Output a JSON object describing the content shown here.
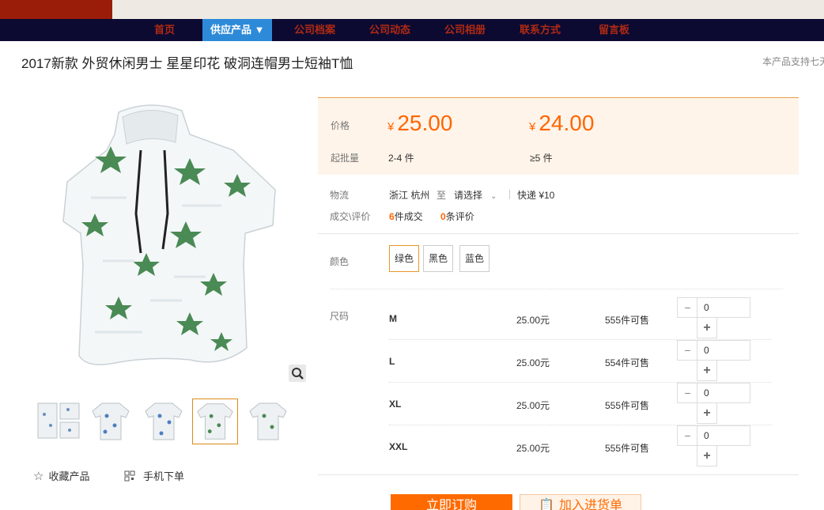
{
  "nav": {
    "items": [
      "首页",
      "供应产品 ▼",
      "公司档案",
      "公司动态",
      "公司相册",
      "联系方式",
      "留言板"
    ]
  },
  "product": {
    "title": "2017新款 外贸休闲男士 星星印花 破洞连帽男士短袖T恤",
    "support_text": "本产品支持七天"
  },
  "pricing": {
    "price_label": "价格",
    "moq_label": "起批量",
    "currency": "¥",
    "tiers": [
      {
        "price": "25.00",
        "qty": "2-4 件"
      },
      {
        "price": "24.00",
        "qty": "≥5 件"
      }
    ]
  },
  "logistics": {
    "label": "物流",
    "from": "浙江 杭州",
    "to_word": "至",
    "select": "请选择",
    "express": "快递 ¥10"
  },
  "deals": {
    "label": "成交\\评价",
    "count": "6",
    "count_suffix": "件成交",
    "reviews": "0",
    "reviews_suffix": "条评价"
  },
  "color": {
    "label": "颜色",
    "options": [
      "绿色",
      "黑色",
      "蓝色"
    ],
    "selected": "绿色"
  },
  "size": {
    "label": "尺码",
    "rows": [
      {
        "size": "M",
        "price": "25.00元",
        "stock": "555件可售",
        "qty": "0"
      },
      {
        "size": "L",
        "price": "25.00元",
        "stock": "554件可售",
        "qty": "0"
      },
      {
        "size": "XL",
        "price": "25.00元",
        "stock": "555件可售",
        "qty": "0"
      },
      {
        "size": "XXL",
        "price": "25.00元",
        "stock": "555件可售",
        "qty": "0"
      }
    ]
  },
  "actions": {
    "favorite": "收藏产品",
    "mobile_order": "手机下单",
    "order_now": "立即订购",
    "add_to_cart": "加入进货单"
  },
  "theme": {
    "accent": "#ff6600",
    "nav_bg": "#0d0a32",
    "nav_active": "#2d8ad8"
  }
}
